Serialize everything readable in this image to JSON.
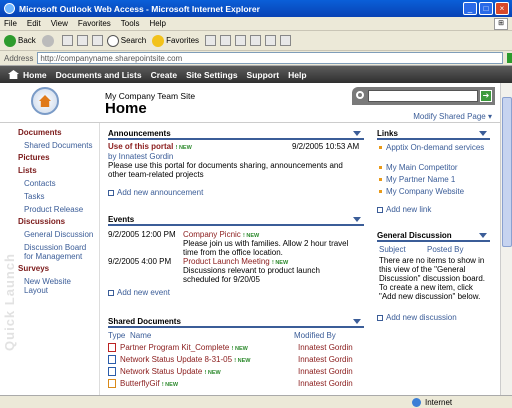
{
  "window": {
    "title": "Microsoft Outlook Web Access - Microsoft Internet Explorer"
  },
  "menu": [
    "File",
    "Edit",
    "View",
    "Favorites",
    "Tools",
    "Help"
  ],
  "toolbar": {
    "back": "Back",
    "search": "Search",
    "favorites": "Favorites"
  },
  "address": {
    "label": "Address",
    "url": "http://companyname.sharepointsite.com",
    "go": "Go"
  },
  "nav": [
    "Home",
    "Documents and Lists",
    "Create",
    "Site Settings",
    "Support",
    "Help"
  ],
  "header": {
    "site_name": "My Company Team Site",
    "page_title": "Home",
    "modify": "Modify Shared Page ▾"
  },
  "quick_launch": {
    "watermark": "Quick Launch",
    "sections": [
      {
        "label": "Documents",
        "items": [
          "Shared Documents"
        ]
      },
      {
        "label": "Pictures",
        "items": []
      },
      {
        "label": "Lists",
        "items": [
          "Contacts",
          "Tasks",
          "Product Release"
        ]
      },
      {
        "label": "Discussions",
        "items": [
          "General Discussion",
          "Discussion Board for Management"
        ]
      },
      {
        "label": "Surveys",
        "items": [
          "New Website Layout"
        ]
      }
    ]
  },
  "announcements": {
    "title": "Announcements",
    "item_title": "Use of this portal",
    "new": "! NEW",
    "date": "9/2/2005 10:53 AM",
    "by": "by Innatest Gordin",
    "body": "Please use this portal for documents sharing, announcements and other team-related projects",
    "add": "Add new announcement"
  },
  "events": {
    "title": "Events",
    "items": [
      {
        "time": "9/2/2005 12:00 PM",
        "title": "Company Picnic",
        "desc": "Please join us with families. Allow 2 hour travel time from the office location."
      },
      {
        "time": "9/2/2005 4:00 PM",
        "title": "Product Launch Meeting",
        "desc": "Discussions relevant to product launch scheduled for 9/20/05"
      }
    ],
    "add": "Add new event"
  },
  "shared_docs": {
    "title": "Shared Documents",
    "col_type": "Type",
    "col_name": "Name",
    "col_modified": "Modified By",
    "rows": [
      {
        "name": "Partner Program Kit_Complete",
        "by": "Innatest Gordin"
      },
      {
        "name": "Network Status Update 8-31-05",
        "by": "Innatest Gordin"
      },
      {
        "name": "Network Status Update",
        "by": "Innatest Gordin"
      },
      {
        "name": "ButterflyGif",
        "by": "Innatest Gordin"
      }
    ]
  },
  "links": {
    "title": "Links",
    "items": [
      "Apptix On-demand services",
      "My Main Competitor",
      "My Partner Name 1",
      "My Company Website"
    ],
    "add": "Add new link"
  },
  "discussion": {
    "title": "General Discussion",
    "col_subject": "Subject",
    "col_posted": "Posted By",
    "body": "There are no items to show in this view of the \"General Discussion\" discussion board. To create a new item, click \"Add new discussion\" below.",
    "add": "Add new discussion"
  },
  "status": {
    "zone": "Internet"
  }
}
